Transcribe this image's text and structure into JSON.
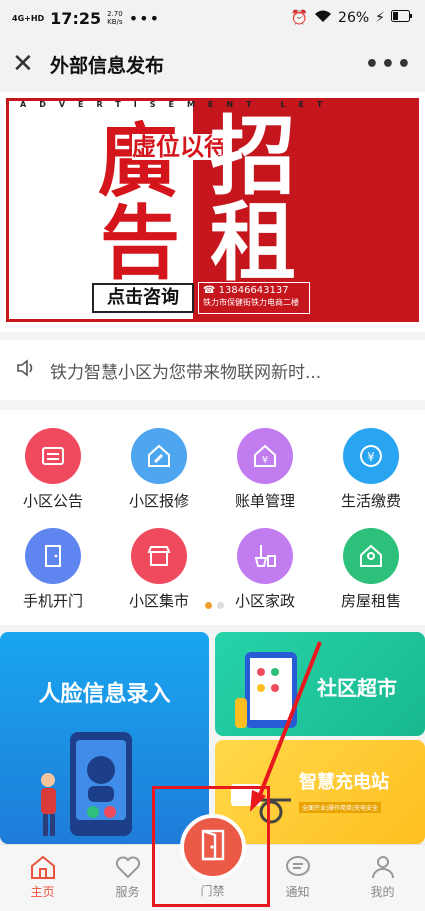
{
  "status_bar": {
    "network": "4G+HD",
    "time": "17:25",
    "speed_value": "2.70",
    "speed_unit": "KB/s",
    "dots": "•••",
    "battery": "26%"
  },
  "title_bar": {
    "title": "外部信息发布",
    "more": "•••"
  },
  "banner": {
    "letters": "ADVERTISEMENT   LET",
    "left_big_1": "廣",
    "left_big_2": "告",
    "left_small": "虚位以待",
    "right_big_1": "招",
    "right_big_2": "租",
    "consult_button": "点击咨询",
    "phone": "☎ 13846643137",
    "address": "铁力市保健街铁力电商二楼"
  },
  "notice": {
    "text": "铁力智慧小区为您带来物联网新时..."
  },
  "grid": {
    "items": [
      {
        "label": "小区公告",
        "color": "#f04a5e",
        "icon": "announcement-icon"
      },
      {
        "label": "小区报修",
        "color": "#4ea5f0",
        "icon": "repair-icon"
      },
      {
        "label": "账单管理",
        "color": "#c17cf0",
        "icon": "bill-icon"
      },
      {
        "label": "生活缴费",
        "color": "#28a4f0",
        "icon": "payment-icon"
      },
      {
        "label": "手机开门",
        "color": "#5f86f0",
        "icon": "door-icon"
      },
      {
        "label": "小区集市",
        "color": "#f04a5e",
        "icon": "market-icon"
      },
      {
        "label": "小区家政",
        "color": "#c17cf0",
        "icon": "housekeeping-icon"
      },
      {
        "label": "房屋租售",
        "color": "#2cc07a",
        "icon": "house-icon"
      }
    ]
  },
  "promos": {
    "face": "人脸信息录入",
    "market": "社区超市",
    "charge": "智慧充电站",
    "charge_sub": "全面开业|操作简单|充电安全"
  },
  "tabbar": {
    "tabs": [
      {
        "label": "主页",
        "icon": "home-icon",
        "active": true
      },
      {
        "label": "服务",
        "icon": "heart-icon",
        "active": false
      },
      {
        "label": "门禁",
        "icon": "door-icon",
        "active": false
      },
      {
        "label": "通知",
        "icon": "message-icon",
        "active": false
      },
      {
        "label": "我的",
        "icon": "user-icon",
        "active": false
      }
    ]
  },
  "colors": {
    "accent": "#e8543e",
    "banner_red": "#c4161c",
    "annotation_red": "#e8191e"
  }
}
